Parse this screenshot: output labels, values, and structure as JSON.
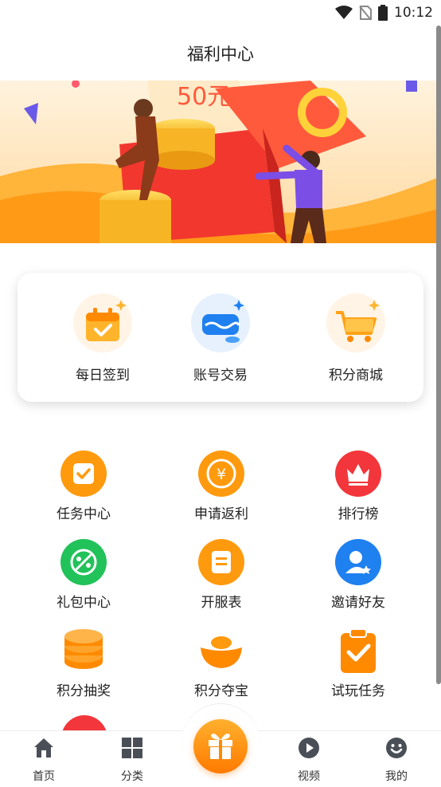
{
  "status_bar": {
    "time": "10:12",
    "icons": [
      "wifi-icon",
      "no-sim-icon",
      "battery-icon"
    ]
  },
  "header": {
    "title": "福利中心"
  },
  "banner": {
    "amount_text": "50元"
  },
  "quick_actions": [
    {
      "label": "每日签到",
      "icon": "calendar-check-icon"
    },
    {
      "label": "账号交易",
      "icon": "account-trade-icon"
    },
    {
      "label": "积分商城",
      "icon": "shopping-cart-icon"
    }
  ],
  "features": [
    {
      "label": "任务中心",
      "icon": "task-check-icon"
    },
    {
      "label": "申请返利",
      "icon": "yuan-coin-icon"
    },
    {
      "label": "排行榜",
      "icon": "crown-icon"
    },
    {
      "label": "礼包中心",
      "icon": "gift-tag-icon"
    },
    {
      "label": "开服表",
      "icon": "server-list-icon"
    },
    {
      "label": "邀请好友",
      "icon": "invite-user-icon"
    },
    {
      "label": "积分抽奖",
      "icon": "coin-stack-icon"
    },
    {
      "label": "积分夺宝",
      "icon": "gold-ingot-icon"
    },
    {
      "label": "试玩任务",
      "icon": "clipboard-check-icon"
    }
  ],
  "bottom_nav": [
    {
      "label": "首页",
      "icon": "home-icon"
    },
    {
      "label": "分类",
      "icon": "category-grid-icon"
    },
    {
      "label": "",
      "icon": "gift-box-icon"
    },
    {
      "label": "视频",
      "icon": "video-play-icon"
    },
    {
      "label": "我的",
      "icon": "smiley-profile-icon"
    }
  ],
  "colors": {
    "accent": "#ff8a00",
    "red": "#f2363b",
    "green": "#21c25a",
    "blue": "#1f80f0"
  }
}
